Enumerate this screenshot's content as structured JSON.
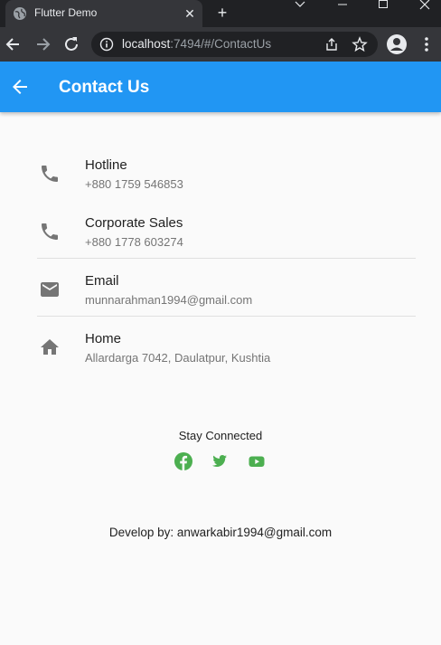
{
  "browser": {
    "tab_title": "Flutter Demo",
    "url_host": "localhost",
    "url_path": ":7494/#/ContactUs"
  },
  "appbar": {
    "title": "Contact Us"
  },
  "contacts": [
    {
      "title": "Hotline",
      "value": "+880 1759 546853",
      "icon": "phone-icon"
    },
    {
      "title": "Corporate Sales",
      "value": "+880 1778 603274",
      "icon": "phone-icon"
    },
    {
      "title": "Email",
      "value": "munnarahman1994@gmail.com",
      "icon": "email-icon"
    },
    {
      "title": "Home",
      "value": "Allardarga 7042, Daulatpur, Kushtia",
      "icon": "home-icon"
    }
  ],
  "social": {
    "heading": "Stay Connected",
    "links": [
      "facebook-icon",
      "twitter-icon",
      "youtube-icon"
    ],
    "color": "#4caf50"
  },
  "footer": {
    "developer": "Develop by: anwarkabir1994@gmail.com"
  },
  "colors": {
    "appbar": "#2196f3",
    "icon": "#757575"
  }
}
